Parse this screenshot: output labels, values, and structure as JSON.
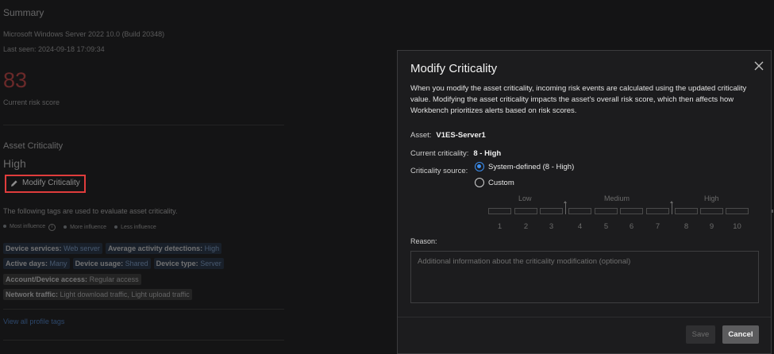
{
  "background": {
    "summary_title": "Summary",
    "os": "Microsoft Windows Server 2022 10.0 (Build 20348)",
    "last_seen": "Last seen: 2024-09-18 17:09:34",
    "risk_score": "83",
    "risk_score_label": "Current risk score",
    "asset_criticality_title": "Asset Criticality",
    "criticality_value": "High",
    "modify_button_label": "Modify Criticality",
    "tags_intro": "The following tags are used to evaluate asset criticality.",
    "legend": {
      "most": "Most influence",
      "more": "More influence",
      "less": "Less influence"
    },
    "tags": {
      "device_services": {
        "key": "Device services:",
        "value": "Web server"
      },
      "avg_activity": {
        "key": "Average activity detections:",
        "value": "High"
      },
      "active_days": {
        "key": "Active days:",
        "value": "Many"
      },
      "device_usage": {
        "key": "Device usage:",
        "value": "Shared"
      },
      "device_type": {
        "key": "Device type:",
        "value": "Server"
      },
      "account_access": {
        "key": "Account/Device access:",
        "value": "Regular access"
      },
      "network_traffic": {
        "key": "Network traffic:",
        "value": "Light download traffic, Light upload traffic"
      }
    },
    "view_all_link": "View all profile tags"
  },
  "modal": {
    "title": "Modify Criticality",
    "description": "When you modify the asset criticality, incoming risk events are calculated using the updated criticality value. Modifying the asset criticality impacts the asset's overall risk score, which then affects how Workbench prioritizes alerts based on risk scores.",
    "asset_label": "Asset:",
    "asset_value": "V1ES-Server1",
    "current_label": "Current criticality:",
    "current_value": "8 - High",
    "source_label": "Criticality source:",
    "source_options": {
      "system": "System-defined (8 - High)",
      "custom": "Custom"
    },
    "selected_source": "system",
    "scale": {
      "groups": [
        "Low",
        "Medium",
        "High"
      ],
      "numbers": [
        "1",
        "2",
        "3",
        "4",
        "5",
        "6",
        "7",
        "8",
        "9",
        "10"
      ]
    },
    "reason_label": "Reason:",
    "reason_placeholder": "Additional information about the criticality modification (optional)",
    "save_label": "Save",
    "cancel_label": "Cancel"
  },
  "colors": {
    "risk_score": "#e04646",
    "accent": "#3b8ef0",
    "highlight_border": "#e03c3c",
    "link": "#4f8de0"
  },
  "icons": {
    "edit": "pencil-icon",
    "close": "close-icon",
    "info": "info-icon"
  }
}
